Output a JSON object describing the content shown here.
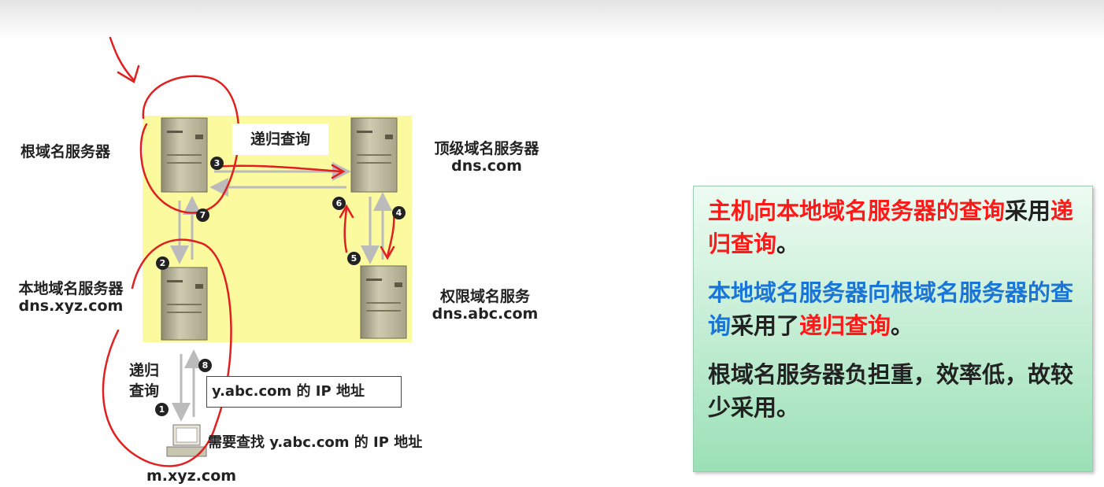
{
  "diagram": {
    "root_server": {
      "name": "根域名服务器"
    },
    "tld_server": {
      "name": "顶级域名服务器",
      "domain": "dns.com"
    },
    "local_server": {
      "name": "本地域名服务器",
      "domain": "dns.xyz.com"
    },
    "auth_server": {
      "name": "权限域名服务",
      "domain": "dns.abc.com"
    },
    "host": {
      "domain": "m.xyz.com",
      "request": "需要查找 y.abc.com 的 IP 地址"
    },
    "recursive_tag": "递归查询",
    "side_label_line1": "递归",
    "side_label_line2": "查询",
    "result_box": "y.abc.com 的 IP 地址",
    "step_numbers": [
      "1",
      "2",
      "3",
      "4",
      "5",
      "6",
      "7",
      "8"
    ]
  },
  "info": {
    "p1_red": "主机向本地域名服务器的查询",
    "p1_text": "采用",
    "p1_red2": "递归查询",
    "p1_end": "。",
    "p2_blue": "本地域名服务器向根域名服务器的查询",
    "p2_text": "采用了",
    "p2_red": "递归查询",
    "p2_end": "。",
    "p3": "根域名服务器负担重，效率低，故较少采用。"
  },
  "colors": {
    "annotation_red": "#e02020",
    "panel_yellow": "#fbfa9e",
    "text_red": "#ff1a1a",
    "text_blue": "#1a75d6"
  }
}
